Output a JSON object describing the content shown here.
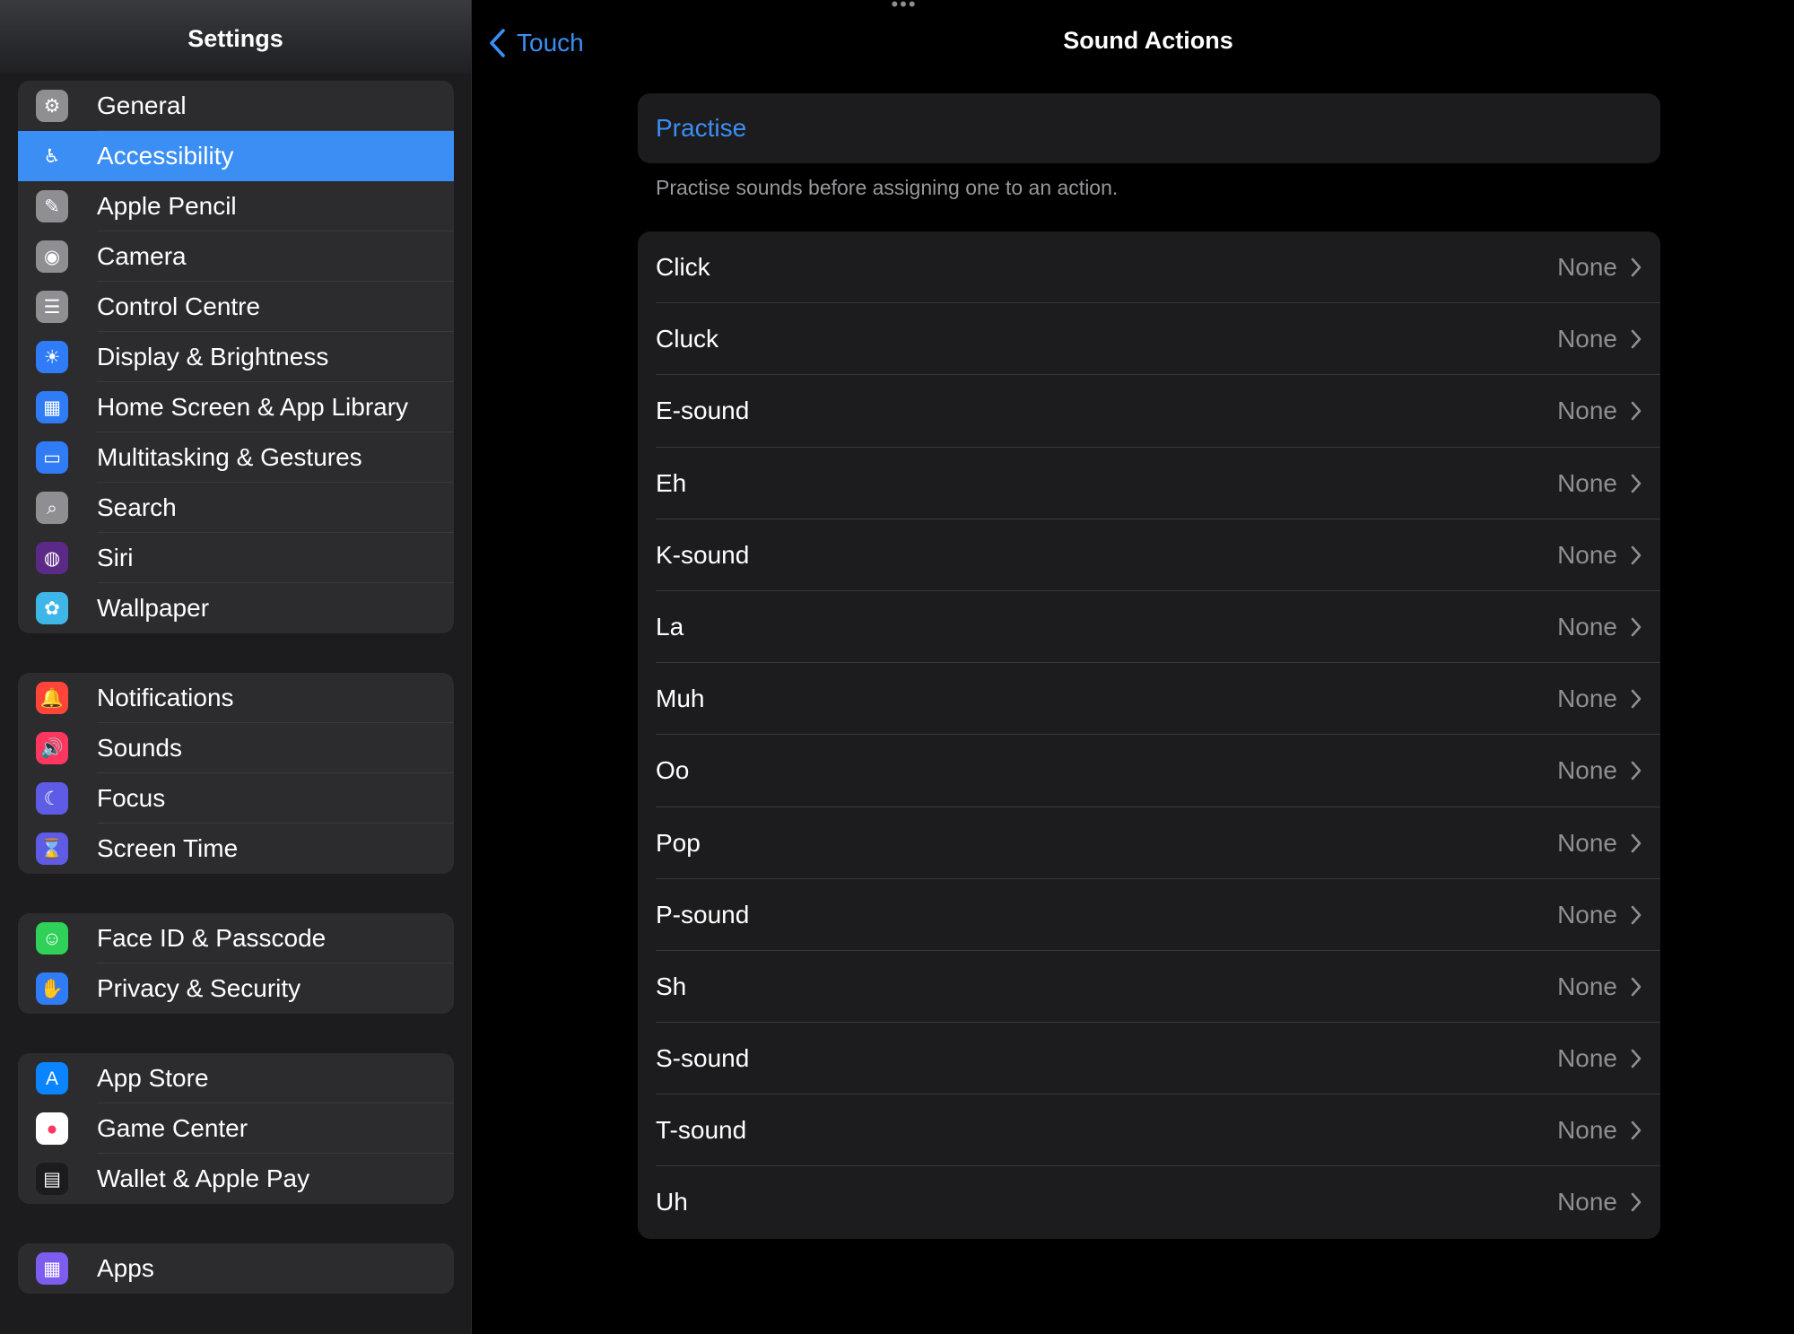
{
  "sidebar": {
    "title": "Settings",
    "groups": [
      [
        {
          "label": "General",
          "icon": "gear-icon",
          "color": "#8e8e93",
          "glyph": "⚙"
        },
        {
          "label": "Accessibility",
          "icon": "accessibility-icon",
          "color": "#3b8ff4",
          "glyph": "♿",
          "selected": true
        },
        {
          "label": "Apple Pencil",
          "icon": "pencil-icon",
          "color": "#8e8e93",
          "glyph": "✎"
        },
        {
          "label": "Camera",
          "icon": "camera-icon",
          "color": "#8e8e93",
          "glyph": "◉"
        },
        {
          "label": "Control Centre",
          "icon": "toggles-icon",
          "color": "#8e8e93",
          "glyph": "☰"
        },
        {
          "label": "Display & Brightness",
          "icon": "sun-icon",
          "color": "#2f7cf6",
          "glyph": "☀"
        },
        {
          "label": "Home Screen & App Library",
          "icon": "home-screen-icon",
          "color": "#2f7cf6",
          "glyph": "▦"
        },
        {
          "label": "Multitasking & Gestures",
          "icon": "multitasking-icon",
          "color": "#2f7cf6",
          "glyph": "▭"
        },
        {
          "label": "Search",
          "icon": "search-icon",
          "color": "#8e8e93",
          "glyph": "⌕"
        },
        {
          "label": "Siri",
          "icon": "siri-icon",
          "color": "#5b2a86",
          "glyph": "◍"
        },
        {
          "label": "Wallpaper",
          "icon": "flower-icon",
          "color": "#3fb6e8",
          "glyph": "✿"
        }
      ],
      [
        {
          "label": "Notifications",
          "icon": "bell-icon",
          "color": "#ff453a",
          "glyph": "🔔"
        },
        {
          "label": "Sounds",
          "icon": "speaker-icon",
          "color": "#ff375f",
          "glyph": "🔊"
        },
        {
          "label": "Focus",
          "icon": "moon-icon",
          "color": "#5e5ce6",
          "glyph": "☾"
        },
        {
          "label": "Screen Time",
          "icon": "hourglass-icon",
          "color": "#5e5ce6",
          "glyph": "⌛"
        }
      ],
      [
        {
          "label": "Face ID & Passcode",
          "icon": "face-id-icon",
          "color": "#30d158",
          "glyph": "☺"
        },
        {
          "label": "Privacy & Security",
          "icon": "hand-icon",
          "color": "#2f7cf6",
          "glyph": "✋"
        }
      ],
      [
        {
          "label": "App Store",
          "icon": "app-store-icon",
          "color": "#0a84ff",
          "glyph": "A"
        },
        {
          "label": "Game Center",
          "icon": "game-center-icon",
          "color": "#ffffff",
          "glyph": "●"
        },
        {
          "label": "Wallet & Apple Pay",
          "icon": "wallet-icon",
          "color": "#1c1c1e",
          "glyph": "▤"
        }
      ],
      [
        {
          "label": "Apps",
          "icon": "apps-grid-icon",
          "color": "#7d5cf0",
          "glyph": "▦"
        }
      ]
    ]
  },
  "nav": {
    "back_label": "Touch",
    "title": "Sound Actions"
  },
  "practise": {
    "label": "Practise",
    "footer": "Practise sounds before assigning one to an action."
  },
  "sounds": [
    {
      "name": "Click",
      "value": "None"
    },
    {
      "name": "Cluck",
      "value": "None"
    },
    {
      "name": "E-sound",
      "value": "None"
    },
    {
      "name": "Eh",
      "value": "None"
    },
    {
      "name": "K-sound",
      "value": "None"
    },
    {
      "name": "La",
      "value": "None"
    },
    {
      "name": "Muh",
      "value": "None"
    },
    {
      "name": "Oo",
      "value": "None"
    },
    {
      "name": "Pop",
      "value": "None"
    },
    {
      "name": "P-sound",
      "value": "None"
    },
    {
      "name": "Sh",
      "value": "None"
    },
    {
      "name": "S-sound",
      "value": "None"
    },
    {
      "name": "T-sound",
      "value": "None"
    },
    {
      "name": "Uh",
      "value": "None"
    }
  ],
  "colors": {
    "accent": "#3b8ff4",
    "background": "#000000",
    "card": "#1c1c1e",
    "secondary_text": "#8e8e93"
  }
}
